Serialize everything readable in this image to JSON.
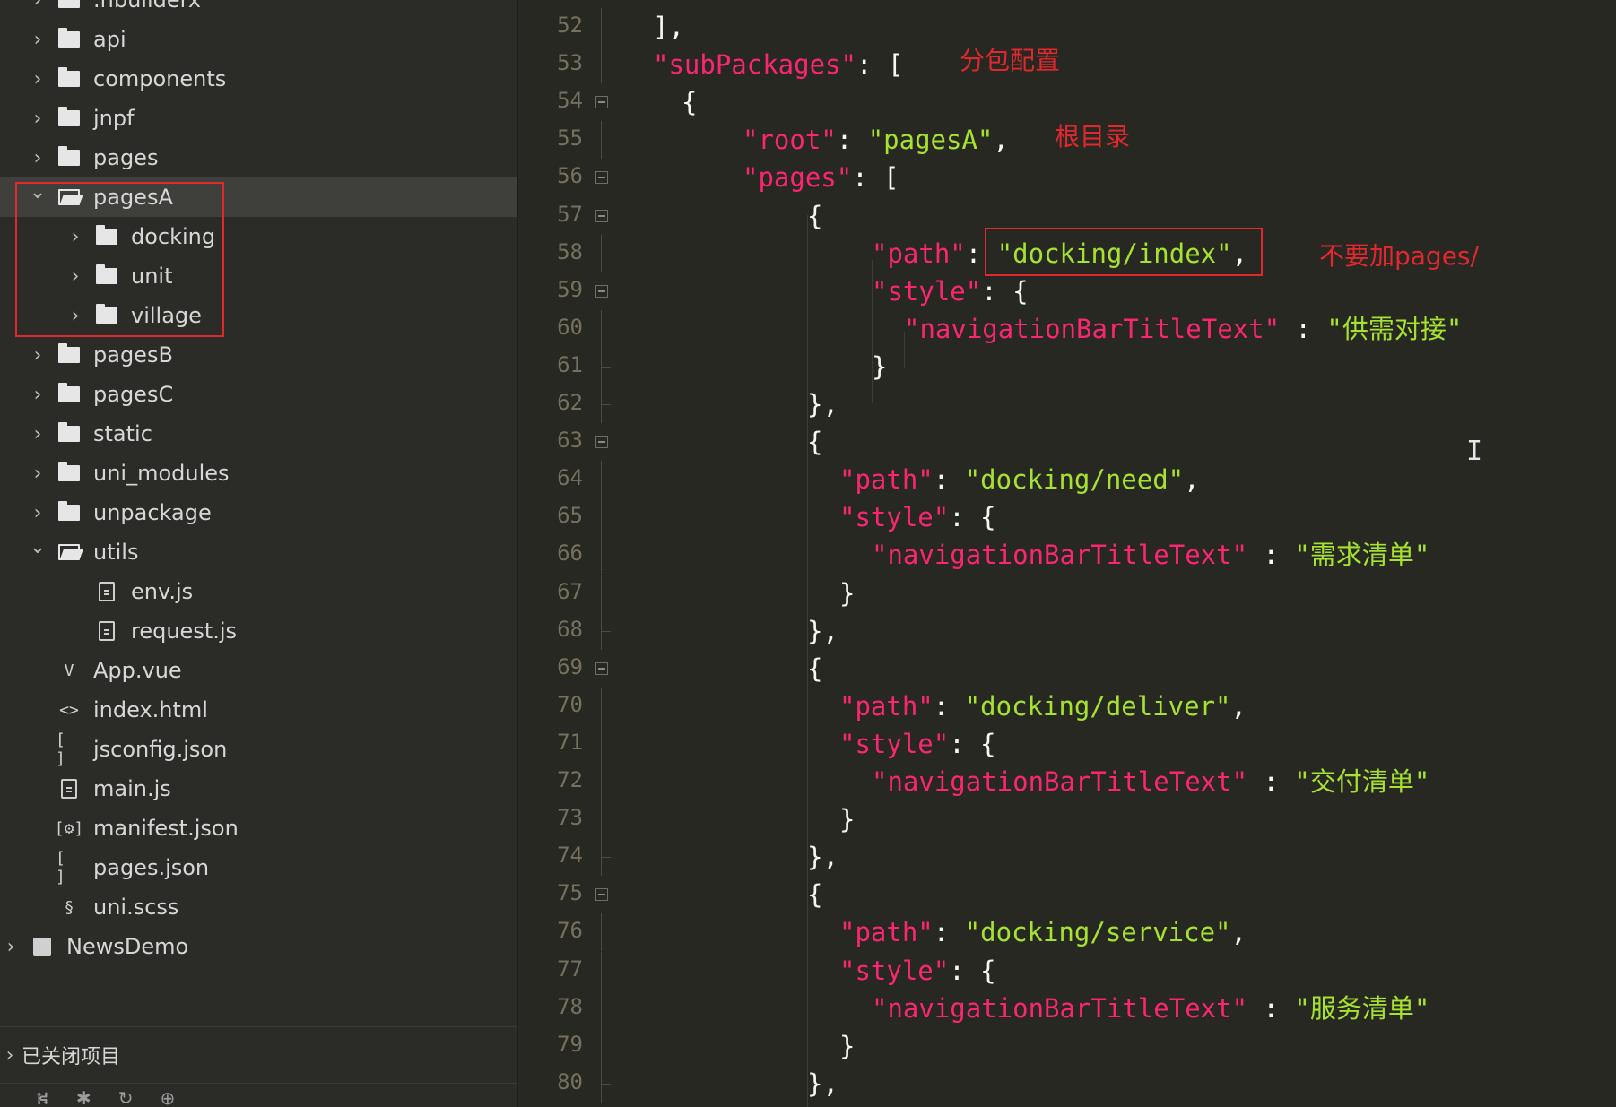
{
  "sidebar": {
    "items": [
      {
        "label": ".hbuilderx",
        "kind": "folder",
        "expanded": false,
        "depth": 1
      },
      {
        "label": "api",
        "kind": "folder",
        "expanded": false,
        "depth": 1
      },
      {
        "label": "components",
        "kind": "folder",
        "expanded": false,
        "depth": 1
      },
      {
        "label": "jnpf",
        "kind": "folder",
        "expanded": false,
        "depth": 1
      },
      {
        "label": "pages",
        "kind": "folder",
        "expanded": false,
        "depth": 1
      },
      {
        "label": "pagesA",
        "kind": "folder",
        "expanded": true,
        "depth": 1,
        "selected": true
      },
      {
        "label": "docking",
        "kind": "folder",
        "expanded": false,
        "depth": 2
      },
      {
        "label": "unit",
        "kind": "folder",
        "expanded": false,
        "depth": 2
      },
      {
        "label": "village",
        "kind": "folder",
        "expanded": false,
        "depth": 2
      },
      {
        "label": "pagesB",
        "kind": "folder",
        "expanded": false,
        "depth": 1
      },
      {
        "label": "pagesC",
        "kind": "folder",
        "expanded": false,
        "depth": 1
      },
      {
        "label": "static",
        "kind": "folder",
        "expanded": false,
        "depth": 1
      },
      {
        "label": "uni_modules",
        "kind": "folder",
        "expanded": false,
        "depth": 1
      },
      {
        "label": "unpackage",
        "kind": "folder",
        "expanded": false,
        "depth": 1
      },
      {
        "label": "utils",
        "kind": "folder",
        "expanded": true,
        "depth": 1
      },
      {
        "label": "env.js",
        "kind": "js-file",
        "depth": 2
      },
      {
        "label": "request.js",
        "kind": "js-file",
        "depth": 2
      },
      {
        "label": "App.vue",
        "kind": "vue-file",
        "depth": 1
      },
      {
        "label": "index.html",
        "kind": "html-file",
        "depth": 1
      },
      {
        "label": "jsconfig.json",
        "kind": "json-file",
        "depth": 1
      },
      {
        "label": "main.js",
        "kind": "js-file",
        "depth": 1
      },
      {
        "label": "manifest.json",
        "kind": "manifest-file",
        "depth": 1
      },
      {
        "label": "pages.json",
        "kind": "json-file",
        "depth": 1
      },
      {
        "label": "uni.scss",
        "kind": "scss-file",
        "depth": 1
      },
      {
        "label": "NewsDemo",
        "kind": "project",
        "expanded": false,
        "depth": 0
      }
    ],
    "closed_projects_label": "已关闭项目",
    "toolbar_icons": [
      "git-icon",
      "debug-icon",
      "refresh-icon",
      "globe-icon"
    ]
  },
  "editor": {
    "lines": [
      {
        "num": "52",
        "fold": "line",
        "tokens": [
          {
            "t": "],",
            "c": "pun"
          }
        ]
      },
      {
        "num": "53",
        "fold": "line",
        "tokens": [
          {
            "t": "\"subPackages\"",
            "c": "key"
          },
          {
            "t": ": [",
            "c": "pun"
          }
        ]
      },
      {
        "num": "54",
        "fold": "box",
        "tokens": [
          {
            "t": "{",
            "c": "pun"
          }
        ]
      },
      {
        "num": "55",
        "fold": "line",
        "tokens": [
          {
            "t": "\"root\"",
            "c": "key"
          },
          {
            "t": ": ",
            "c": "pun"
          },
          {
            "t": "\"pagesA\"",
            "c": "str"
          },
          {
            "t": ",",
            "c": "pun"
          }
        ]
      },
      {
        "num": "56",
        "fold": "box",
        "tokens": [
          {
            "t": "\"pages\"",
            "c": "key"
          },
          {
            "t": ": [",
            "c": "pun"
          }
        ]
      },
      {
        "num": "57",
        "fold": "box",
        "tokens": [
          {
            "t": "{",
            "c": "pun"
          }
        ]
      },
      {
        "num": "58",
        "fold": "line",
        "tokens": [
          {
            "t": "\"path\"",
            "c": "key"
          },
          {
            "t": ": ",
            "c": "pun"
          },
          {
            "t": "\"docking/index\"",
            "c": "str"
          },
          {
            "t": ",",
            "c": "pun"
          }
        ]
      },
      {
        "num": "59",
        "fold": "box",
        "tokens": [
          {
            "t": "\"style\"",
            "c": "key"
          },
          {
            "t": ": {",
            "c": "pun"
          }
        ]
      },
      {
        "num": "60",
        "fold": "line",
        "tokens": [
          {
            "t": "\"navigationBarTitleText\"",
            "c": "key"
          },
          {
            "t": " : ",
            "c": "pun"
          },
          {
            "t": "\"供需对接\"",
            "c": "str"
          }
        ]
      },
      {
        "num": "61",
        "fold": "end",
        "tokens": [
          {
            "t": "}",
            "c": "pun"
          }
        ]
      },
      {
        "num": "62",
        "fold": "end",
        "tokens": [
          {
            "t": "},",
            "c": "pun"
          }
        ]
      },
      {
        "num": "63",
        "fold": "box",
        "tokens": [
          {
            "t": "{",
            "c": "pun"
          }
        ]
      },
      {
        "num": "64",
        "fold": "line",
        "tokens": [
          {
            "t": "\"path\"",
            "c": "key"
          },
          {
            "t": ": ",
            "c": "pun"
          },
          {
            "t": "\"docking/need\"",
            "c": "str"
          },
          {
            "t": ",",
            "c": "pun"
          }
        ]
      },
      {
        "num": "65",
        "fold": "line",
        "tokens": [
          {
            "t": "\"style\"",
            "c": "key"
          },
          {
            "t": ": {",
            "c": "pun"
          }
        ]
      },
      {
        "num": "66",
        "fold": "line",
        "tokens": [
          {
            "t": "\"navigationBarTitleText\"",
            "c": "key"
          },
          {
            "t": " : ",
            "c": "pun"
          },
          {
            "t": "\"需求清单\"",
            "c": "str"
          }
        ]
      },
      {
        "num": "67",
        "fold": "line",
        "tokens": [
          {
            "t": "}",
            "c": "pun"
          }
        ]
      },
      {
        "num": "68",
        "fold": "end",
        "tokens": [
          {
            "t": "},",
            "c": "pun"
          }
        ]
      },
      {
        "num": "69",
        "fold": "box",
        "tokens": [
          {
            "t": "{",
            "c": "pun"
          }
        ]
      },
      {
        "num": "70",
        "fold": "line",
        "tokens": [
          {
            "t": "\"path\"",
            "c": "key"
          },
          {
            "t": ": ",
            "c": "pun"
          },
          {
            "t": "\"docking/deliver\"",
            "c": "str"
          },
          {
            "t": ",",
            "c": "pun"
          }
        ]
      },
      {
        "num": "71",
        "fold": "line",
        "tokens": [
          {
            "t": "\"style\"",
            "c": "key"
          },
          {
            "t": ": {",
            "c": "pun"
          }
        ]
      },
      {
        "num": "72",
        "fold": "line",
        "tokens": [
          {
            "t": "\"navigationBarTitleText\"",
            "c": "key"
          },
          {
            "t": " : ",
            "c": "pun"
          },
          {
            "t": "\"交付清单\"",
            "c": "str"
          }
        ]
      },
      {
        "num": "73",
        "fold": "line",
        "tokens": [
          {
            "t": "}",
            "c": "pun"
          }
        ]
      },
      {
        "num": "74",
        "fold": "end",
        "tokens": [
          {
            "t": "},",
            "c": "pun"
          }
        ]
      },
      {
        "num": "75",
        "fold": "box",
        "tokens": [
          {
            "t": "{",
            "c": "pun"
          }
        ]
      },
      {
        "num": "76",
        "fold": "line",
        "tokens": [
          {
            "t": "\"path\"",
            "c": "key"
          },
          {
            "t": ": ",
            "c": "pun"
          },
          {
            "t": "\"docking/service\"",
            "c": "str"
          },
          {
            "t": ",",
            "c": "pun"
          }
        ]
      },
      {
        "num": "77",
        "fold": "line",
        "tokens": [
          {
            "t": "\"style\"",
            "c": "key"
          },
          {
            "t": ": {",
            "c": "pun"
          }
        ]
      },
      {
        "num": "78",
        "fold": "line",
        "tokens": [
          {
            "t": "\"navigationBarTitleText\"",
            "c": "key"
          },
          {
            "t": " : ",
            "c": "pun"
          },
          {
            "t": "\"服务清单\"",
            "c": "str"
          }
        ]
      },
      {
        "num": "79",
        "fold": "line",
        "tokens": [
          {
            "t": "}",
            "c": "pun"
          }
        ]
      },
      {
        "num": "80",
        "fold": "end",
        "tokens": [
          {
            "t": "},",
            "c": "pun"
          }
        ]
      }
    ],
    "annotations": {
      "subpackages_note": "分包配置",
      "root_note": "根目录",
      "path_note": "不要加pages/"
    }
  },
  "colors": {
    "background": "#272822",
    "sidebar": "#2b2c27",
    "key": "#f92672",
    "string": "#a6e22e",
    "annotation": "#e0282e",
    "line_number": "#75715e"
  }
}
